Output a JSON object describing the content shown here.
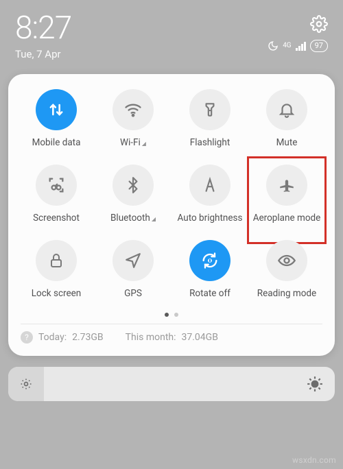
{
  "status": {
    "time": "8:27",
    "date": "Tue, 7 Apr",
    "network_type": "4G",
    "battery_pct": "97"
  },
  "tiles": [
    {
      "label": "Mobile data",
      "icon": "mobile-data",
      "active": true
    },
    {
      "label": "Wi-Fi",
      "icon": "wifi",
      "expandable": true
    },
    {
      "label": "Flashlight",
      "icon": "flashlight"
    },
    {
      "label": "Mute",
      "icon": "bell"
    },
    {
      "label": "Screenshot",
      "icon": "screenshot"
    },
    {
      "label": "Bluetooth",
      "icon": "bluetooth",
      "expandable": true
    },
    {
      "label": "Auto brightness",
      "icon": "auto-brightness"
    },
    {
      "label": "Aeroplane mode",
      "icon": "airplane",
      "highlighted": true
    },
    {
      "label": "Lock screen",
      "icon": "lock"
    },
    {
      "label": "GPS",
      "icon": "gps"
    },
    {
      "label": "Rotate off",
      "icon": "rotate",
      "active": true
    },
    {
      "label": "Reading mode",
      "icon": "reading"
    }
  ],
  "pager": {
    "count": 2,
    "active": 0
  },
  "usage": {
    "today_label": "Today:",
    "today_value": "2.73GB",
    "month_label": "This month:",
    "month_value": "37.04GB"
  },
  "watermark": "wsxdn.com"
}
